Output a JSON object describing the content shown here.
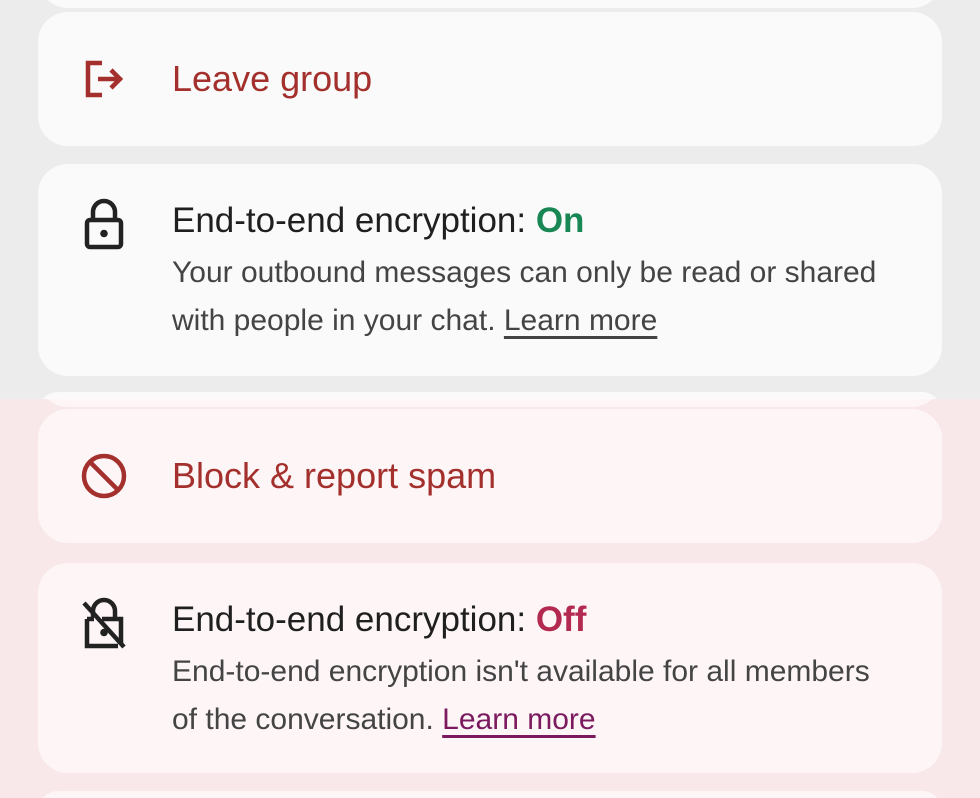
{
  "top_panel": {
    "leave_group": {
      "label": "Leave group",
      "icon": "exit-icon",
      "color": "#a3302c"
    },
    "encryption_on": {
      "title_prefix": "End-to-end encryption: ",
      "status": "On",
      "status_color": "#198754",
      "description": "Your outbound messages can only be read or shared with people in your chat.",
      "learn_more": "Learn more",
      "icon": "lock-icon"
    }
  },
  "bottom_panel": {
    "block_spam": {
      "label": "Block & report spam",
      "icon": "block-icon",
      "color": "#a3302c"
    },
    "encryption_off": {
      "title_prefix": "End-to-end encryption: ",
      "status": "Off",
      "status_color": "#b3294f",
      "description": "End-to-end encryption isn't available for all members of the conversation.",
      "learn_more": "Learn more",
      "icon": "lock-off-icon"
    }
  }
}
